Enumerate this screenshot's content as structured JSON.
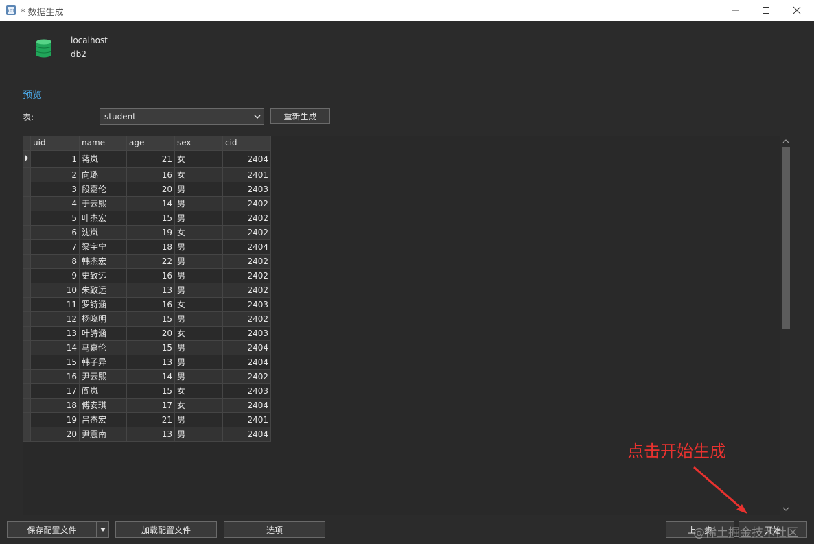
{
  "window": {
    "title": "* 数据生成",
    "min_glyph": "–",
    "max_glyph": "☐",
    "close_glyph": "✕"
  },
  "connection": {
    "name": "localhost",
    "database": "db2"
  },
  "preview": {
    "title": "预览",
    "table_label": "表:",
    "table_value": "student",
    "regen_label": "重新生成"
  },
  "grid": {
    "columns": [
      "uid",
      "name",
      "age",
      "sex",
      "cid"
    ],
    "rows": [
      [
        "1",
        "蒋岚",
        "21",
        "女",
        "2404"
      ],
      [
        "2",
        "向璐",
        "16",
        "女",
        "2401"
      ],
      [
        "3",
        "段嘉伦",
        "20",
        "男",
        "2403"
      ],
      [
        "4",
        "于云熙",
        "14",
        "男",
        "2402"
      ],
      [
        "5",
        "叶杰宏",
        "15",
        "男",
        "2402"
      ],
      [
        "6",
        "沈岚",
        "19",
        "女",
        "2402"
      ],
      [
        "7",
        "梁宇宁",
        "18",
        "男",
        "2404"
      ],
      [
        "8",
        "韩杰宏",
        "22",
        "男",
        "2402"
      ],
      [
        "9",
        "史致远",
        "16",
        "男",
        "2402"
      ],
      [
        "10",
        "朱致远",
        "13",
        "男",
        "2402"
      ],
      [
        "11",
        "罗詩涵",
        "16",
        "女",
        "2403"
      ],
      [
        "12",
        "杨晓明",
        "15",
        "男",
        "2402"
      ],
      [
        "13",
        "叶詩涵",
        "20",
        "女",
        "2403"
      ],
      [
        "14",
        "马嘉伦",
        "15",
        "男",
        "2404"
      ],
      [
        "15",
        "韩子异",
        "13",
        "男",
        "2404"
      ],
      [
        "16",
        "尹云熙",
        "14",
        "男",
        "2402"
      ],
      [
        "17",
        "阎岚",
        "15",
        "女",
        "2403"
      ],
      [
        "18",
        "傅安琪",
        "17",
        "女",
        "2404"
      ],
      [
        "19",
        "吕杰宏",
        "21",
        "男",
        "2401"
      ],
      [
        "20",
        "尹震南",
        "13",
        "男",
        "2404"
      ]
    ]
  },
  "footer": {
    "save_label": "保存配置文件",
    "load_label": "加载配置文件",
    "options_label": "选项",
    "prev_label": "上一步",
    "start_label": "开始"
  },
  "annotation": {
    "text": "点击开始生成",
    "color": "#e8322f"
  },
  "watermark": "@稀土掘金技术社区",
  "colors": {
    "accent": "#4aa3df",
    "background": "#2b2b2b"
  }
}
